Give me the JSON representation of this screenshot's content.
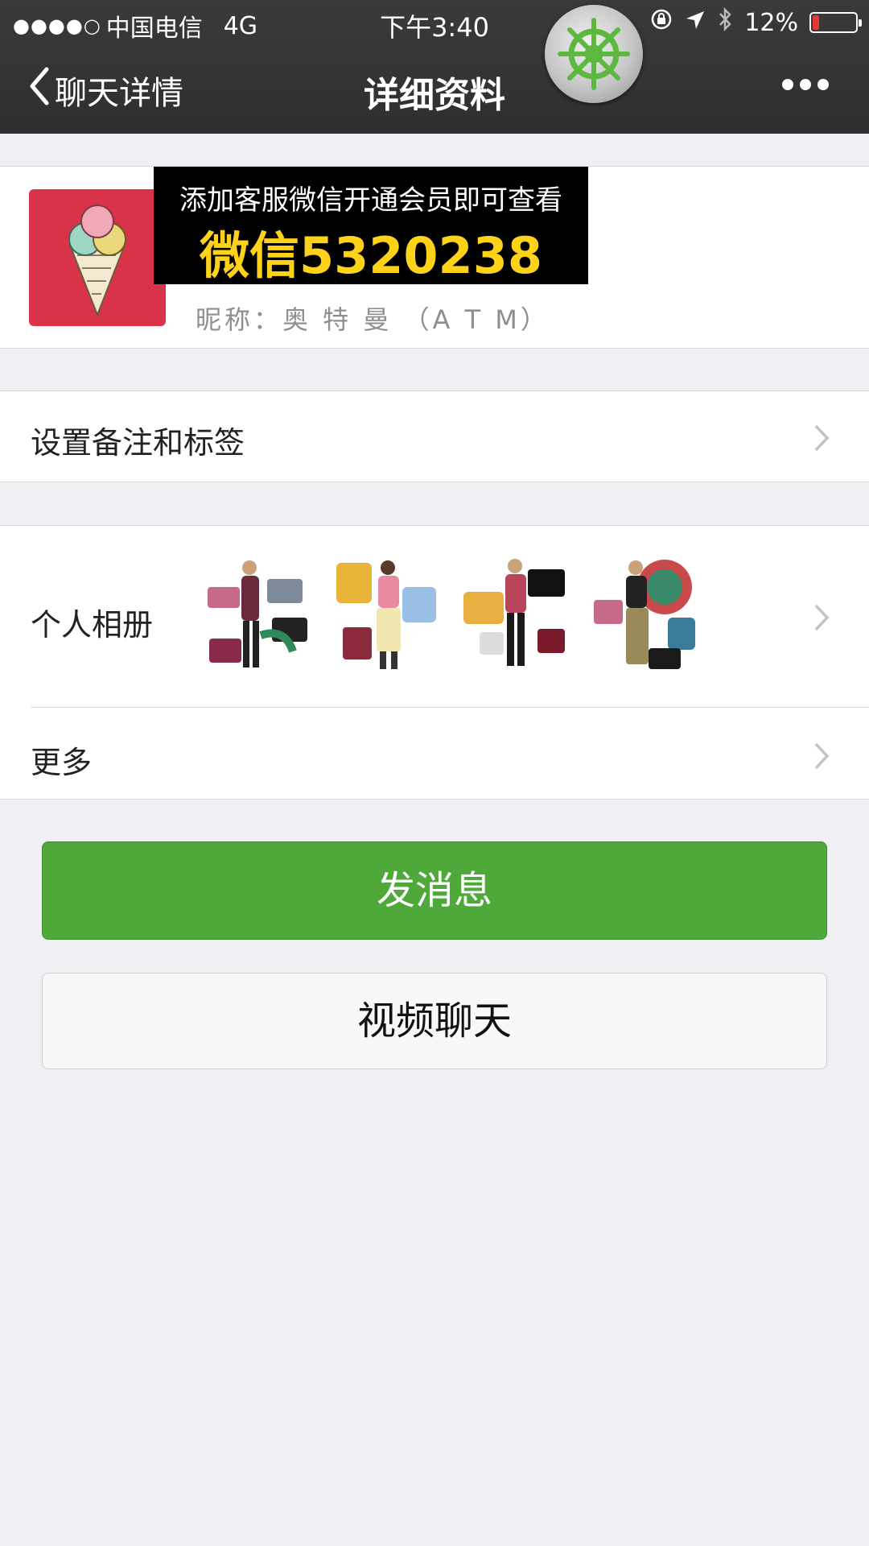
{
  "status_bar": {
    "signal_dots": "●●●●○",
    "carrier": "中国电信",
    "network": "4G",
    "time": "下午3:40",
    "battery": "12%"
  },
  "nav": {
    "back_label": "聊天详情",
    "title": "详细资料"
  },
  "profile": {
    "ad_line1": "添加客服微信开通会员即可查看",
    "ad_line2": "微信5320238",
    "nickname": "昵称：奥 特 曼 （A T M）"
  },
  "rows": {
    "remark_label": "设置备注和标签",
    "album_label": "个人相册",
    "more_label": "更多"
  },
  "buttons": {
    "send_message": "发消息",
    "video_chat": "视频聊天"
  },
  "colors": {
    "nav_bg": "#2f2f31",
    "accent_green": "#4ea83a",
    "ad_text_yellow": "#ffd21a",
    "avatar_red": "#d9334a"
  }
}
